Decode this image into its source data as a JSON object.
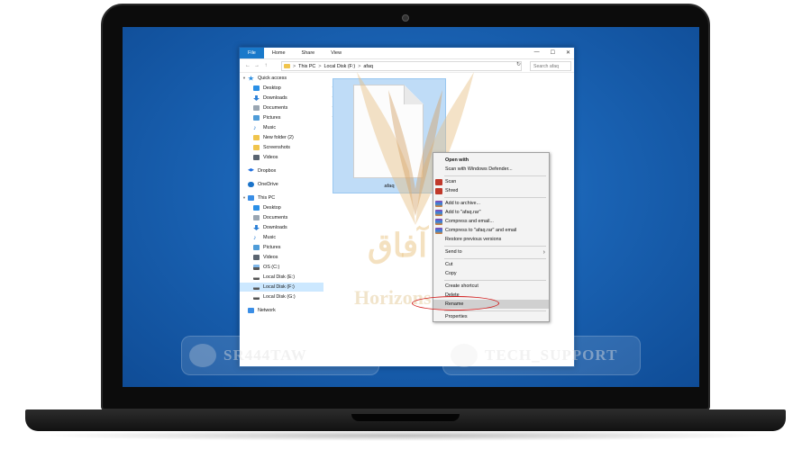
{
  "ribbon": {
    "tabs": [
      "File",
      "Home",
      "Share",
      "View"
    ]
  },
  "window_controls": {
    "minimize": "—",
    "maximize": "☐",
    "close": "✕"
  },
  "address": {
    "back": "←",
    "forward": "→",
    "up": "↑",
    "path": [
      "This PC",
      "Local Disk (F:)",
      "afaq"
    ],
    "separator": ">",
    "refresh": "↻",
    "search_placeholder": "Search afaq"
  },
  "sidebar": {
    "quick_access": "Quick access",
    "quick_items": [
      "Desktop",
      "Downloads",
      "Documents",
      "Pictures",
      "Music",
      "New folder (2)",
      "Screenshots",
      "Videos"
    ],
    "pin": "📌",
    "dropbox": "Dropbox",
    "onedrive": "OneDrive",
    "this_pc": "This PC",
    "pc_items": [
      "Desktop",
      "Documents",
      "Downloads",
      "Music",
      "Pictures",
      "Videos",
      "OS (C:)",
      "Local Disk (E:)",
      "Local Disk (F:)",
      "Local Disk (G:)"
    ],
    "network": "Network"
  },
  "file": {
    "name": "afaq"
  },
  "context_menu": {
    "open_with": "Open with",
    "scan_defender": "Scan with Windows Defender...",
    "scan": "Scan",
    "shred": "Shred",
    "add_archive": "Add to archive...",
    "add_rar": "Add to \"afaq.rar\"",
    "compress_email": "Compress and email...",
    "compress_rar_email": "Compress to \"afaq.rar\" and email",
    "restore": "Restore previous versions",
    "send_to": "Send to",
    "cut": "Cut",
    "copy": "Copy",
    "create_shortcut": "Create shortcut",
    "delete": "Delete",
    "rename": "Rename",
    "properties": "Properties",
    "submenu_arrow": "›"
  },
  "watermarks": {
    "arabic": "آفاق",
    "horizons": "Horizons",
    "left_badge": "SR444TAW",
    "right_badge": "TECH_SUPPORT"
  },
  "colors": {
    "file_tab": "#1979ca",
    "desktop": "#1a63b4",
    "selection": "#bfdcf7",
    "highlight_ring": "#d21b1b"
  }
}
